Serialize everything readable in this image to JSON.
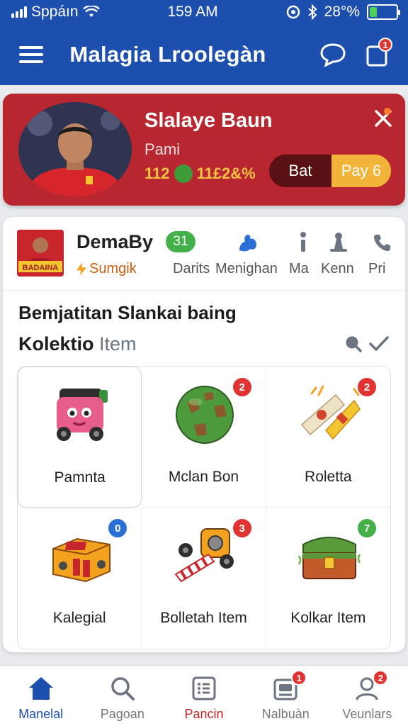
{
  "status": {
    "carrier": "Sppáın",
    "time": "159 AM",
    "battery": "28°%"
  },
  "app": {
    "title": "Malagia Lroolegàn",
    "notif_count": "1"
  },
  "player": {
    "name": "Slalaye Baun",
    "subtitle": "Pami",
    "stat1": "112",
    "stat2": "11£2&%",
    "bet_label": "Bat",
    "pay_label": "Pay 6"
  },
  "game": {
    "logo_text": "BADAINA",
    "name": "DemaBy",
    "count": "31",
    "tag": "Sumgik",
    "labels": [
      "Darits",
      "Menighan",
      "Ma",
      "Kenn",
      "Pri"
    ]
  },
  "section": {
    "heading": "Bemjatitan Slankai baing",
    "title": "Kolektio",
    "title_suffix": "Item"
  },
  "items": [
    {
      "label": "Pamnta",
      "badge": "",
      "badge_color": ""
    },
    {
      "label": "Mclan Bon",
      "badge": "2",
      "badge_color": "#e23333"
    },
    {
      "label": "Roletta",
      "badge": "2",
      "badge_color": "#e23333"
    },
    {
      "label": "Kalegial",
      "badge": "0",
      "badge_color": "#2a6fd6"
    },
    {
      "label": "Bolletah Item",
      "badge": "3",
      "badge_color": "#e23333"
    },
    {
      "label": "Kolkar Item",
      "badge": "7",
      "badge_color": "#44b04a"
    }
  ],
  "nav": [
    {
      "label": "Manelal",
      "badge": ""
    },
    {
      "label": "Pagoan",
      "badge": ""
    },
    {
      "label": "Pancin",
      "badge": ""
    },
    {
      "label": "Nalbuàn",
      "badge": "1"
    },
    {
      "label": "Veunlars",
      "badge": "2"
    }
  ],
  "colors": {
    "primary": "#1d4fae",
    "player_card": "#b8262f",
    "accent_gold": "#f2b53a",
    "badge_red": "#e23333"
  }
}
